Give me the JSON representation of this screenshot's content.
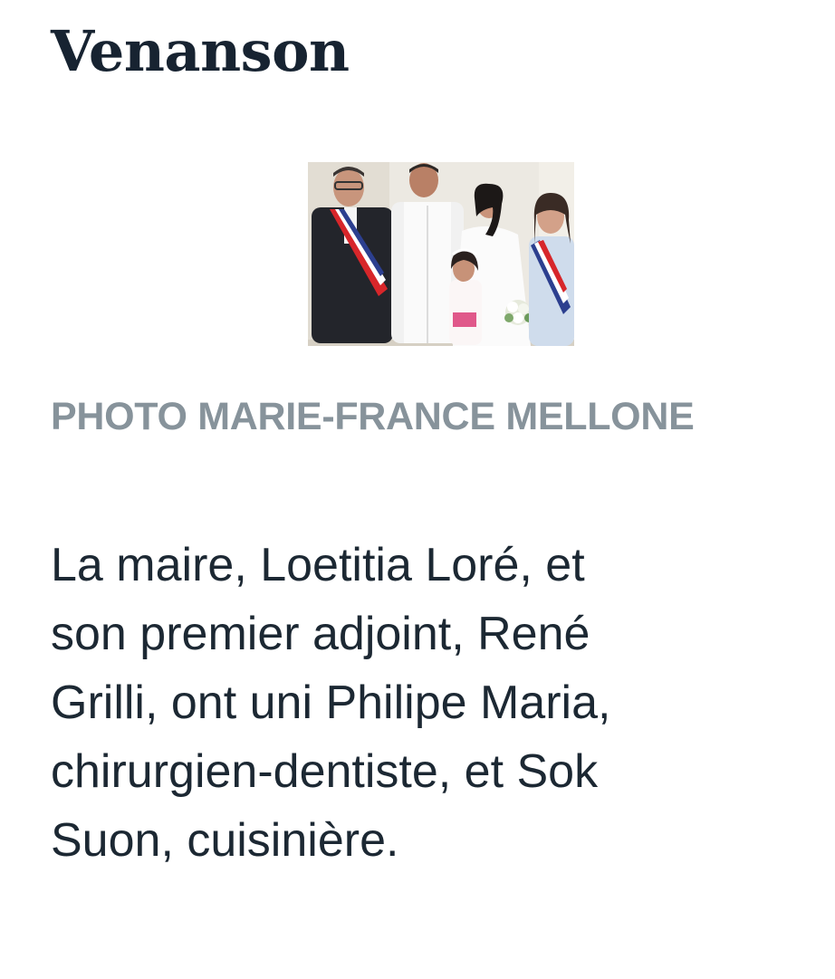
{
  "article": {
    "town": "Venanson",
    "photo_credit": "PHOTO MARIE-FRANCE MELLONE",
    "body_lines": [
      "La maire, Loetitia Loré, et",
      "son premier adjoint, René",
      "Grilli, ont uni Philipe Maria,",
      "chirurgien-dentiste, et Sok",
      "Suon, cuisinière."
    ]
  },
  "colors": {
    "title": "#172331",
    "credit": "#87939b",
    "body": "#1c2833"
  }
}
